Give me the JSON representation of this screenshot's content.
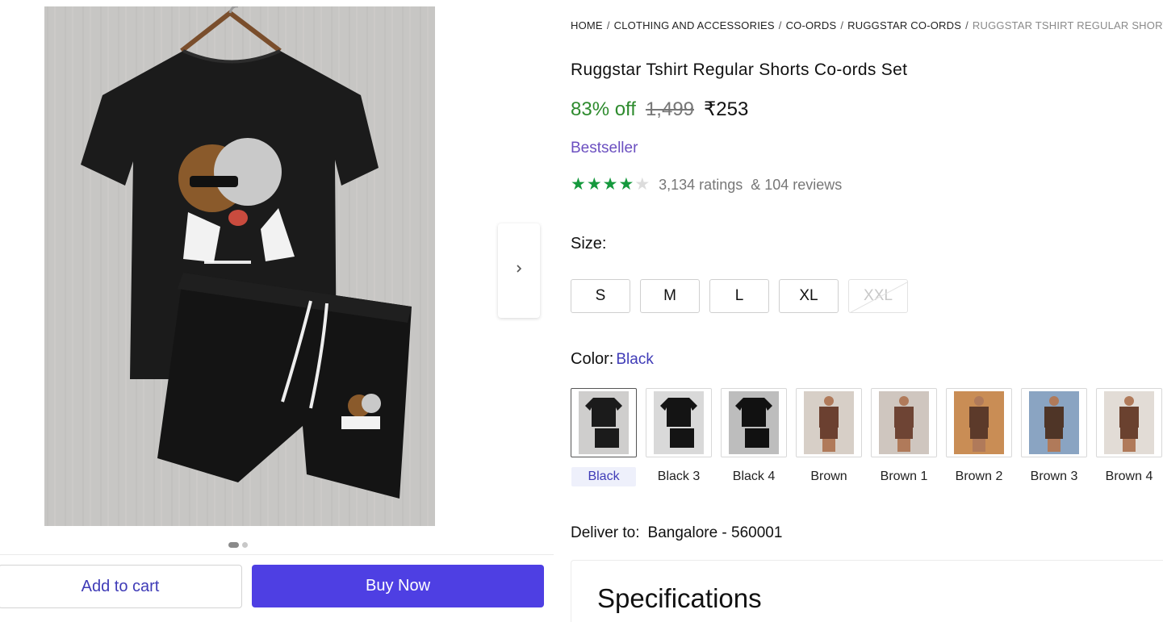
{
  "gallery": {
    "dots": [
      true,
      false
    ],
    "next_icon": "chevron-right-icon"
  },
  "actions": {
    "add_to_cart": "Add to cart",
    "buy_now": "Buy Now"
  },
  "breadcrumb": [
    "HOME",
    "CLOTHING AND ACCESSORIES",
    "CO-ORDS",
    "RUGGSTAR CO-ORDS",
    "RUGGSTAR TSHIRT REGULAR SHORTS"
  ],
  "product": {
    "title": "Ruggstar Tshirt Regular Shorts Co-ords Set",
    "discount": "83% off",
    "mrp": "1,499",
    "price": "₹253",
    "badge": "Bestseller",
    "rating": 4,
    "rating_max": 5,
    "ratings_count": "3,134 ratings",
    "reviews_count": "& 104 reviews"
  },
  "size": {
    "label": "Size:",
    "options": [
      {
        "label": "S",
        "available": true
      },
      {
        "label": "M",
        "available": true
      },
      {
        "label": "L",
        "available": true
      },
      {
        "label": "XL",
        "available": true
      },
      {
        "label": "XXL",
        "available": false
      }
    ]
  },
  "color": {
    "label": "Color:",
    "selected": "Black",
    "options": [
      {
        "label": "Black",
        "selected": true,
        "shirt": "#1b1b1b",
        "bg": "#cfcecd",
        "person": false
      },
      {
        "label": "Black 3",
        "selected": false,
        "shirt": "#141414",
        "bg": "#d9d9d9",
        "person": false
      },
      {
        "label": "Black 4",
        "selected": false,
        "shirt": "#111111",
        "bg": "#bdbdbd",
        "person": false
      },
      {
        "label": "Brown",
        "selected": false,
        "shirt": "#6b4030",
        "bg": "#d7cfc7",
        "person": true
      },
      {
        "label": "Brown 1",
        "selected": false,
        "shirt": "#6e4434",
        "bg": "#cfc6bf",
        "person": true
      },
      {
        "label": "Brown 2",
        "selected": false,
        "shirt": "#5c3a2a",
        "bg": "#c98d55",
        "person": true
      },
      {
        "label": "Brown 3",
        "selected": false,
        "shirt": "#4f3527",
        "bg": "#8aa4c2",
        "person": true
      },
      {
        "label": "Brown 4",
        "selected": false,
        "shirt": "#6a412f",
        "bg": "#e2dcd6",
        "person": true
      }
    ]
  },
  "delivery": {
    "label": "Deliver to:",
    "location": "Bangalore - 560001"
  },
  "specs": {
    "title": "Specifications"
  },
  "colors": {
    "accent": "#4e3fe3",
    "link": "#3f3bb7",
    "discount": "#2e8b2e",
    "star": "#15993d",
    "badge": "#6b4fc0"
  }
}
